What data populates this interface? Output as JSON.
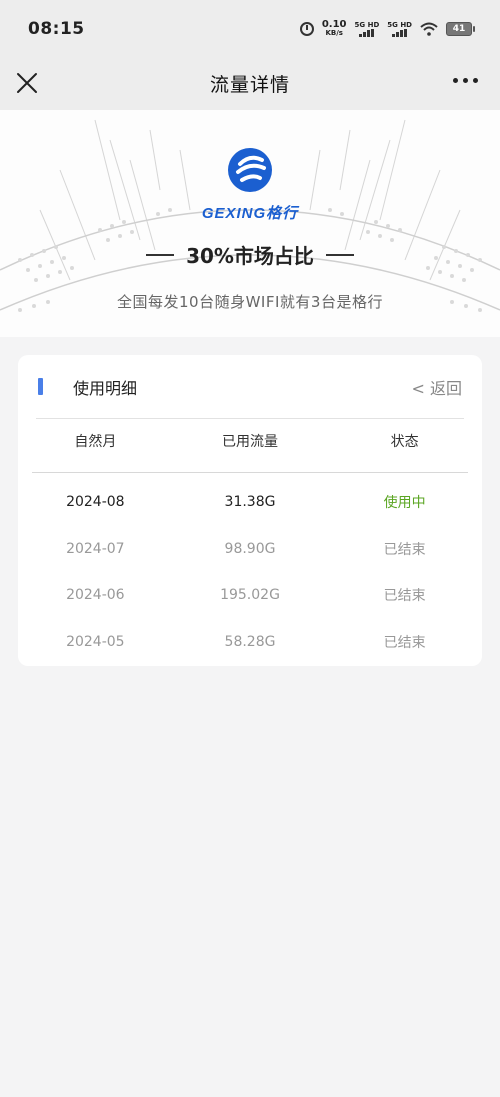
{
  "status_bar": {
    "time": "08:15",
    "net_speed": "0.10",
    "net_unit": "KB/s",
    "sim1_label": "5G HD",
    "sim2_label": "5G HD",
    "battery": "41",
    "icons": [
      "alarm-icon",
      "signal-icon",
      "wifi-icon",
      "battery-icon"
    ]
  },
  "nav": {
    "title": "流量详情",
    "close_icon": "close-icon",
    "more_icon": "more-icon"
  },
  "banner": {
    "brand": "GEXING格行",
    "headline": "30%市场占比",
    "subline": "全国每发10台随身WIFI就有3台是格行",
    "brand_color": "#1b5fd0"
  },
  "usage": {
    "title": "使用明细",
    "back_label": "< 返回",
    "columns": [
      "自然月",
      "已用流量",
      "状态"
    ],
    "rows": [
      {
        "month": "2024-08",
        "used": "31.38G",
        "status": "使用中"
      },
      {
        "month": "2024-07",
        "used": "98.90G",
        "status": "已结束"
      },
      {
        "month": "2024-06",
        "used": "195.02G",
        "status": "已结束"
      },
      {
        "month": "2024-05",
        "used": "58.28G",
        "status": "已结束"
      }
    ],
    "accent_color": "#4a7fe8",
    "active_status_color": "#5ba623"
  }
}
